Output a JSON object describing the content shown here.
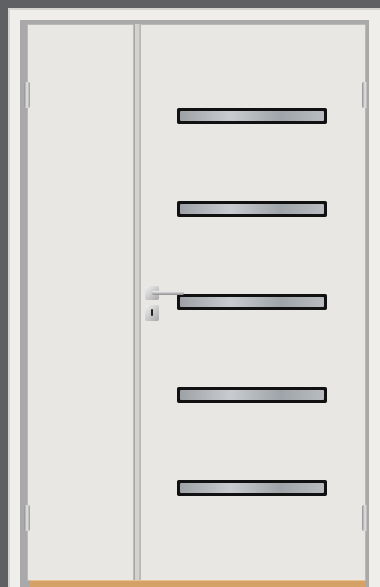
{
  "scene": {
    "subject": "door-image",
    "colors": {
      "background": "#5f6063",
      "door": "#e8e7e3",
      "frame": "#efeeea",
      "glass": "#b5b9bd",
      "glass_border": "#111111",
      "threshold": "#d4a166"
    },
    "glass_panels": [
      {
        "name": "glass-panel-1"
      },
      {
        "name": "glass-panel-2"
      },
      {
        "name": "glass-panel-3"
      },
      {
        "name": "glass-panel-4"
      },
      {
        "name": "glass-panel-5"
      }
    ]
  }
}
